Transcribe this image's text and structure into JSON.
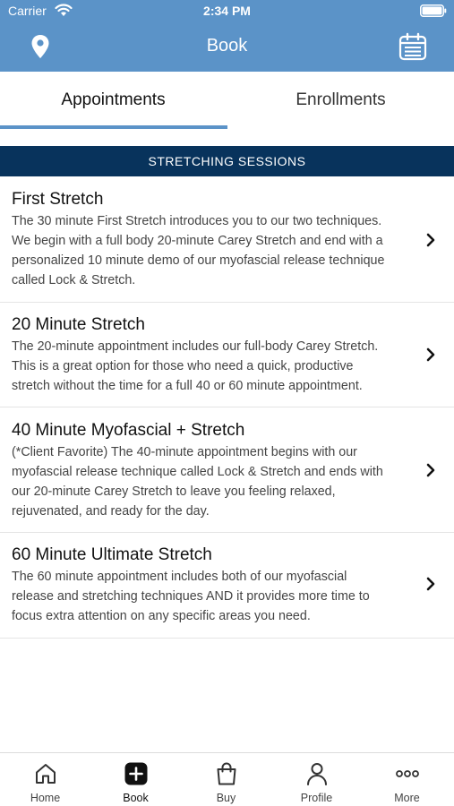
{
  "status_bar": {
    "carrier": "Carrier",
    "time": "2:34 PM"
  },
  "nav": {
    "title": "Book",
    "left_icon": "location-pin-icon",
    "right_icon": "calendar-icon"
  },
  "tabs": [
    {
      "label": "Appointments",
      "active": true
    },
    {
      "label": "Enrollments",
      "active": false
    }
  ],
  "section": {
    "title": "STRETCHING SESSIONS"
  },
  "sessions": [
    {
      "title": "First Stretch",
      "lines": [
        "The 30 minute First Stretch introduces you to our two techniques.",
        "We begin with a full body 20-minute Carey Stretch and end with a",
        "personalized 10 minute demo of our myofascial release technique",
        "called Lock & Stretch."
      ]
    },
    {
      "title": "20 Minute Stretch",
      "lines": [
        "The 20-minute appointment includes our full-body Carey Stretch.",
        "This is a great option for those who need a quick, productive",
        "stretch without the time for a full 40 or 60 minute appointment."
      ]
    },
    {
      "title": "40 Minute Myofascial + Stretch",
      "lines": [
        "(*Client Favorite) The 40-minute appointment begins with our",
        "myofascial release technique called Lock & Stretch and ends with",
        "our 20-minute Carey Stretch to leave you feeling relaxed,",
        "rejuvenated, and ready for the day."
      ]
    },
    {
      "title": "60 Minute Ultimate Stretch",
      "lines": [
        "The 60 minute appointment includes both of our myofascial",
        "release and stretching techniques AND it provides more time to",
        "focus extra attention on any specific areas you need."
      ]
    }
  ],
  "tabbar": [
    {
      "label": "Home",
      "icon": "home-icon",
      "active": false
    },
    {
      "label": "Book",
      "icon": "plus-square-icon",
      "active": true
    },
    {
      "label": "Buy",
      "icon": "shopping-bag-icon",
      "active": false
    },
    {
      "label": "Profile",
      "icon": "user-icon",
      "active": false
    },
    {
      "label": "More",
      "icon": "ellipsis-icon",
      "active": false
    }
  ],
  "colors": {
    "header": "#5b93c8",
    "section_header": "#08335c",
    "tab_underline": "#5b93c8"
  }
}
